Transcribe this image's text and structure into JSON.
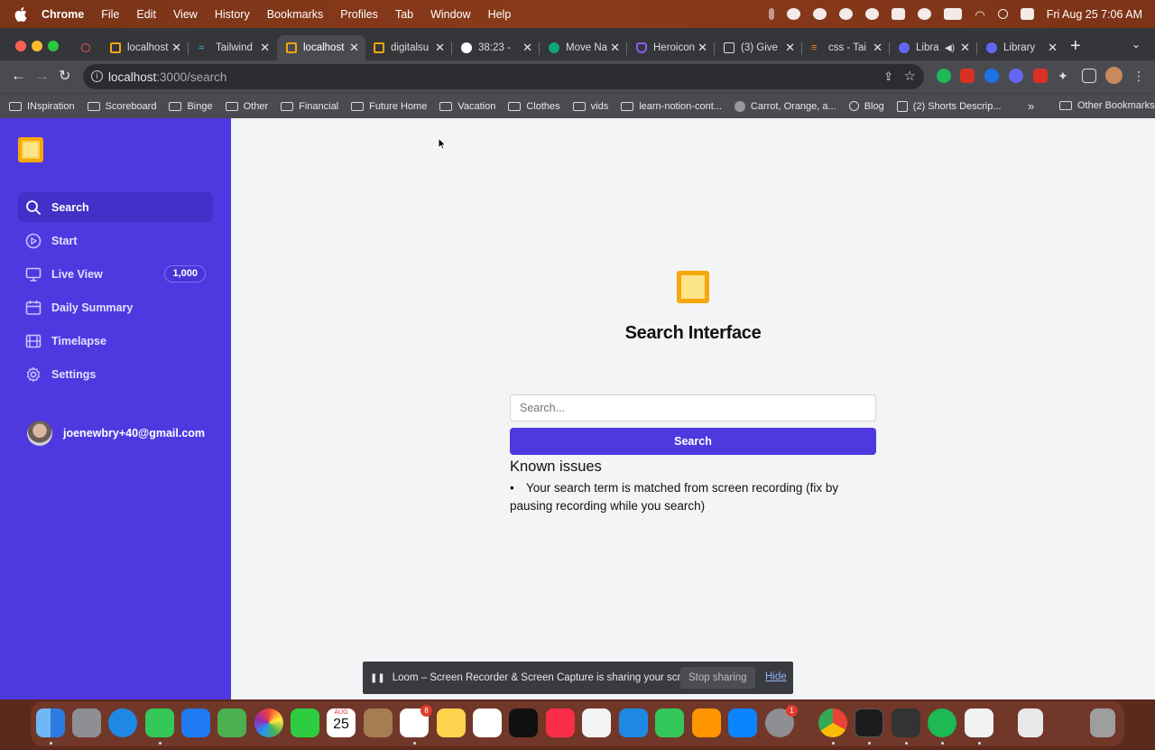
{
  "menubar": {
    "app": "Chrome",
    "items": [
      "File",
      "Edit",
      "View",
      "History",
      "Bookmarks",
      "Profiles",
      "Tab",
      "Window",
      "Help"
    ],
    "datetime": "Fri Aug 25  7:06 AM"
  },
  "tabs": [
    {
      "label": "localhost",
      "color": "#f5a70b"
    },
    {
      "label": "Tailwind",
      "color": "#38bdf8"
    },
    {
      "label": "localhost",
      "color": "#f5a70b",
      "active": true
    },
    {
      "label": "digitalsu",
      "color": "#f5a70b"
    },
    {
      "label": "38:23 -",
      "color": "#ffffff"
    },
    {
      "label": "Move Na",
      "color": "#10a37f"
    },
    {
      "label": "Heroicon",
      "color": "#8b5cf6"
    },
    {
      "label": "(3) Give",
      "color": "#dddddd"
    },
    {
      "label": "css - Tai",
      "color": "#f48024"
    },
    {
      "label": "Libra",
      "color": "#6366f1"
    },
    {
      "label": "Library",
      "color": "#6366f1"
    }
  ],
  "address": {
    "host": "localhost",
    "path": ":3000/search"
  },
  "bookmarks": [
    "INspiration",
    "Scoreboard",
    "Binge",
    "Other",
    "Financial",
    "Future Home",
    "Vacation",
    "Clothes",
    "vids",
    "learn-notion-cont...",
    "Carrot, Orange, a...",
    "Blog",
    "(2) Shorts Descrip..."
  ],
  "bookmarks_more": "»",
  "bookmarks_other": "Other Bookmarks",
  "sidebar": {
    "items": [
      {
        "label": "Search",
        "icon": "search-icon",
        "active": true
      },
      {
        "label": "Start",
        "icon": "play-icon"
      },
      {
        "label": "Live View",
        "icon": "monitor-icon",
        "badge": "1,000"
      },
      {
        "label": "Daily Summary",
        "icon": "calendar-icon"
      },
      {
        "label": "Timelapse",
        "icon": "film-icon"
      },
      {
        "label": "Settings",
        "icon": "gear-icon"
      }
    ],
    "user_email": "joenewbry+40@gmail.com"
  },
  "main": {
    "title": "Search Interface",
    "search_placeholder": "Search...",
    "search_button": "Search",
    "known_issues_heading": "Known issues",
    "issues": [
      "Your search term is matched from screen recording (fix by pausing recording while you search)"
    ]
  },
  "loom": {
    "message": "Loom – Screen Recorder & Screen Capture is sharing your screen.",
    "stop_label": "Stop sharing",
    "hide_label": "Hide"
  },
  "dock": {
    "calendar_month": "AUG",
    "calendar_day": "25",
    "reminders_badge": "8",
    "settings_badge": "1"
  },
  "colors": {
    "sidebar": "#4f38e0",
    "accent": "#f5a70b",
    "page_bg": "#f3f4f6"
  }
}
